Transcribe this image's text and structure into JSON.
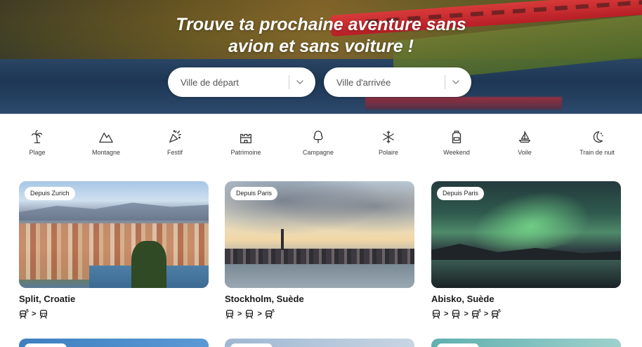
{
  "hero": {
    "title_line1": "Trouve ta prochaine aventure sans",
    "title_line2": "avion et sans voiture !",
    "departure_placeholder": "Ville de départ",
    "arrival_placeholder": "Ville d'arrivée"
  },
  "categories": [
    {
      "label": "Plage",
      "icon": "palm-tree-icon"
    },
    {
      "label": "Montagne",
      "icon": "mountain-icon"
    },
    {
      "label": "Festif",
      "icon": "party-popper-icon"
    },
    {
      "label": "Patrimoine",
      "icon": "castle-icon"
    },
    {
      "label": "Campagne",
      "icon": "tree-icon"
    },
    {
      "label": "Polaire",
      "icon": "snowflake-icon"
    },
    {
      "label": "Weekend",
      "icon": "backpack-icon"
    },
    {
      "label": "Voile",
      "icon": "sailboat-icon"
    },
    {
      "label": "Train de nuit",
      "icon": "moon-stars-icon"
    }
  ],
  "destinations": [
    {
      "badge": "Depuis Zurich",
      "title": "Split, Croatie",
      "route": [
        "night-train-icon",
        "train-icon"
      ]
    },
    {
      "badge": "Depuis Paris",
      "title": "Stockholm, Suède",
      "route": [
        "train-icon",
        "train-icon",
        "night-train-icon"
      ]
    },
    {
      "badge": "Depuis Paris",
      "title": "Abisko, Suède",
      "route": [
        "train-icon",
        "train-icon",
        "night-train-icon",
        "night-train-icon"
      ]
    }
  ],
  "route_separator": ">"
}
